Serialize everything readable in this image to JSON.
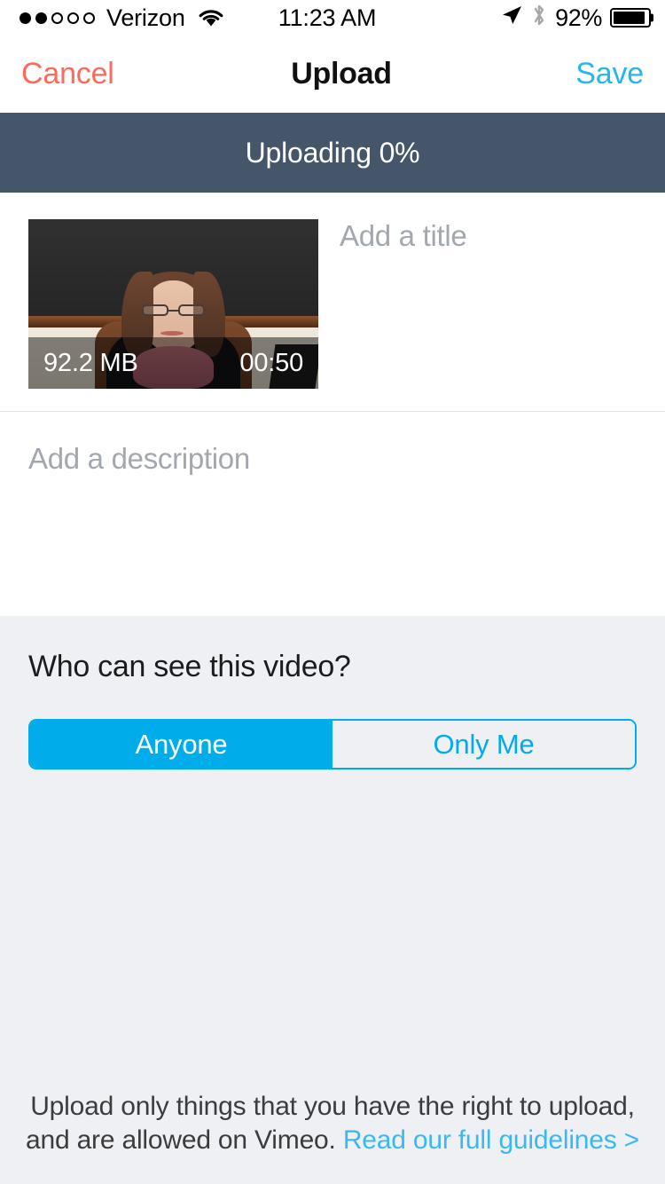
{
  "status_bar": {
    "carrier": "Verizon",
    "signal_dots_total": 5,
    "signal_dots_filled": 2,
    "wifi_icon": "wifi-icon",
    "time": "11:23 AM",
    "location_icon": "location-arrow-icon",
    "bluetooth_icon": "bluetooth-icon",
    "battery_percent": "92%",
    "battery_icon": "battery-icon"
  },
  "nav_bar": {
    "cancel_label": "Cancel",
    "title": "Upload",
    "save_label": "Save"
  },
  "upload_banner": {
    "text": "Uploading 0%",
    "progress_percent": 0,
    "background_color": "#46566a"
  },
  "media": {
    "thumbnail_name": "video-thumbnail",
    "file_size": "92.2 MB",
    "duration": "00:50",
    "title_placeholder": "Add a title",
    "title_value": ""
  },
  "description": {
    "placeholder": "Add a description",
    "value": ""
  },
  "privacy": {
    "question": "Who can see this video?",
    "options": [
      {
        "label": "Anyone",
        "selected": true
      },
      {
        "label": "Only Me",
        "selected": false
      }
    ],
    "accent_color": "#00ace9"
  },
  "footer": {
    "note_text": "Upload only things that you have the right to upload, and are allowed on Vimeo. ",
    "link_text": "Read our full guidelines >"
  },
  "colors": {
    "cancel_red": "#fc6a5b",
    "save_blue": "#23b7ec",
    "accent_cyan": "#00ace9",
    "banner_slate": "#46566a",
    "section_gray": "#eff0f4",
    "placeholder_gray": "#a3a8b0"
  }
}
